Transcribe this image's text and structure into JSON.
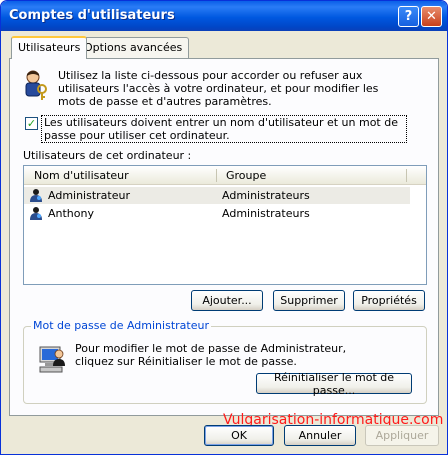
{
  "window": {
    "title": "Comptes d'utilisateurs",
    "help_label": "?",
    "close_label": "✕"
  },
  "tabs": [
    {
      "label": "Utilisateurs",
      "active": true
    },
    {
      "label": "Options avancées",
      "active": false
    }
  ],
  "intro": {
    "text": "Utilisez la liste ci-dessous pour accorder ou refuser aux utilisateurs l'accès à votre ordinateur, et pour modifier les mots de passe et d'autres paramètres.",
    "icon": "users-keys-icon"
  },
  "require_login": {
    "checked": true,
    "label": "Les utilisateurs doivent entrer un nom d'utilisateur et un mot de passe pour utiliser cet ordinateur."
  },
  "users_list": {
    "label": "Utilisateurs de cet ordinateur :",
    "columns": [
      "Nom d'utilisateur",
      "Groupe"
    ],
    "rows": [
      {
        "name": "Administrateur",
        "group": "Administrateurs",
        "selected": true
      },
      {
        "name": "Anthony",
        "group": "Administrateurs",
        "selected": false
      }
    ]
  },
  "actions": {
    "add": "Ajouter...",
    "remove": "Supprimer",
    "properties": "Propriétés"
  },
  "admin_password": {
    "group_title": "Mot de passe de Administrateur",
    "text": "Pour modifier le mot de passe de Administrateur, cliquez sur Réinitialiser le mot de passe.",
    "reset_button": "Réinitialiser le mot de passe...",
    "icon": "computer-user-icon"
  },
  "watermark": "Vulgarisation-informatique.com",
  "dialog_buttons": {
    "ok": "OK",
    "cancel": "Annuler",
    "apply": "Appliquer"
  },
  "colors": {
    "titlebar": "#0058e0",
    "dialog_bg": "#ece9d8",
    "group_title": "#0046d5",
    "watermark": "#ff1a1a"
  }
}
